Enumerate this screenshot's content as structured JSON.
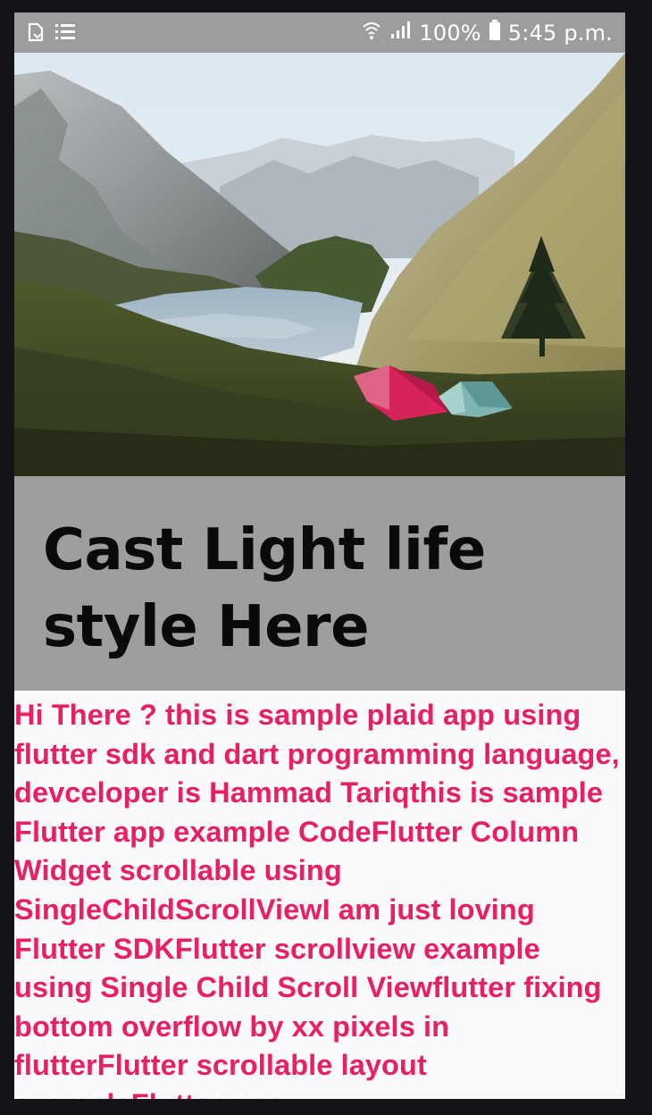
{
  "status_bar": {
    "left_icons": [
      "notification-icon",
      "list-icon"
    ],
    "battery": "100%",
    "time": "5:45 p.m.",
    "right_icons": [
      "wifi-icon",
      "signal-icon",
      "battery-icon"
    ]
  },
  "hero": {
    "image": "mountain-lake-camping-tents-photo"
  },
  "title": "Cast Light life style Here",
  "body": "Hi There ? this is sample plaid app using flutter sdk and dart programming language, devceloper is Hammad Tariqthis is sample Flutter app example CodeFlutter Column Widget scrollable using SingleChildScrollViewI am just loving Flutter SDKFlutter scrollview example using Single Child Scroll Viewflutter fixing bottom overflow by xx pixels in flutterFlutter scrollable layout exampleFlutter app",
  "colors": {
    "status_bar_bg": "#9d9d9d",
    "title_banner_bg": "#9e9e9e",
    "title_text": "#0a0a0a",
    "body_text": "#e91e63",
    "page_bg": "#fafafa"
  }
}
